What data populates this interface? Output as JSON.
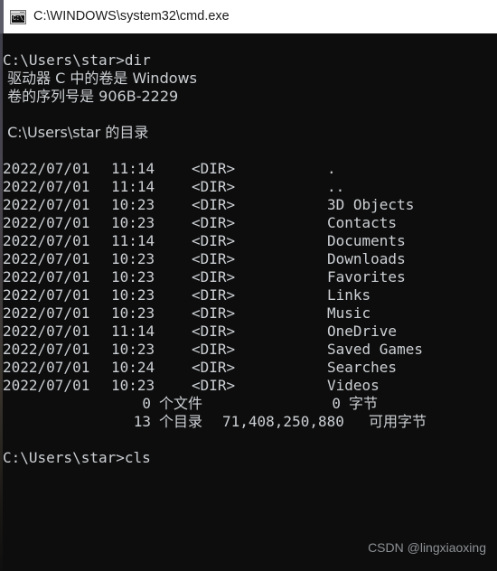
{
  "window": {
    "title": "C:\\WINDOWS\\system32\\cmd.exe",
    "icon": "cmd-console-icon",
    "icon_glyph": "C:\\_",
    "titlebar_bg": "#ffffff",
    "titlebar_fg": "#1b1b1b",
    "console_bg": "#0d0d0d",
    "console_fg": "#ccd0d4"
  },
  "console": {
    "prompt_1": "C:\\Users\\star>dir",
    "volume_line": " 驱动器 C 中的卷是 Windows",
    "serial_line": " 卷的序列号是 906B-2229",
    "directory_of": " C:\\Users\\star 的目录",
    "listing": [
      {
        "date": "2022/07/01",
        "time": "11:14",
        "type": "<DIR>",
        "name": "."
      },
      {
        "date": "2022/07/01",
        "time": "11:14",
        "type": "<DIR>",
        "name": ".."
      },
      {
        "date": "2022/07/01",
        "time": "10:23",
        "type": "<DIR>",
        "name": "3D Objects"
      },
      {
        "date": "2022/07/01",
        "time": "10:23",
        "type": "<DIR>",
        "name": "Contacts"
      },
      {
        "date": "2022/07/01",
        "time": "11:14",
        "type": "<DIR>",
        "name": "Documents"
      },
      {
        "date": "2022/07/01",
        "time": "10:23",
        "type": "<DIR>",
        "name": "Downloads"
      },
      {
        "date": "2022/07/01",
        "time": "10:23",
        "type": "<DIR>",
        "name": "Favorites"
      },
      {
        "date": "2022/07/01",
        "time": "10:23",
        "type": "<DIR>",
        "name": "Links"
      },
      {
        "date": "2022/07/01",
        "time": "10:23",
        "type": "<DIR>",
        "name": "Music"
      },
      {
        "date": "2022/07/01",
        "time": "11:14",
        "type": "<DIR>",
        "name": "OneDrive"
      },
      {
        "date": "2022/07/01",
        "time": "10:23",
        "type": "<DIR>",
        "name": "Saved Games"
      },
      {
        "date": "2022/07/01",
        "time": "10:24",
        "type": "<DIR>",
        "name": "Searches"
      },
      {
        "date": "2022/07/01",
        "time": "10:23",
        "type": "<DIR>",
        "name": "Videos"
      }
    ],
    "summary_files": {
      "count": "0",
      "label": "个文件",
      "bytes": "0",
      "bytes_label": "字节"
    },
    "summary_dirs": {
      "count": "13",
      "label": "个目录",
      "bytes": "71,408,250,880",
      "bytes_label": "可用字节"
    },
    "prompt_2": "C:\\Users\\star>cls"
  },
  "watermark": {
    "text": "CSDN @lingxiaoxing",
    "color": "#8d9296"
  }
}
